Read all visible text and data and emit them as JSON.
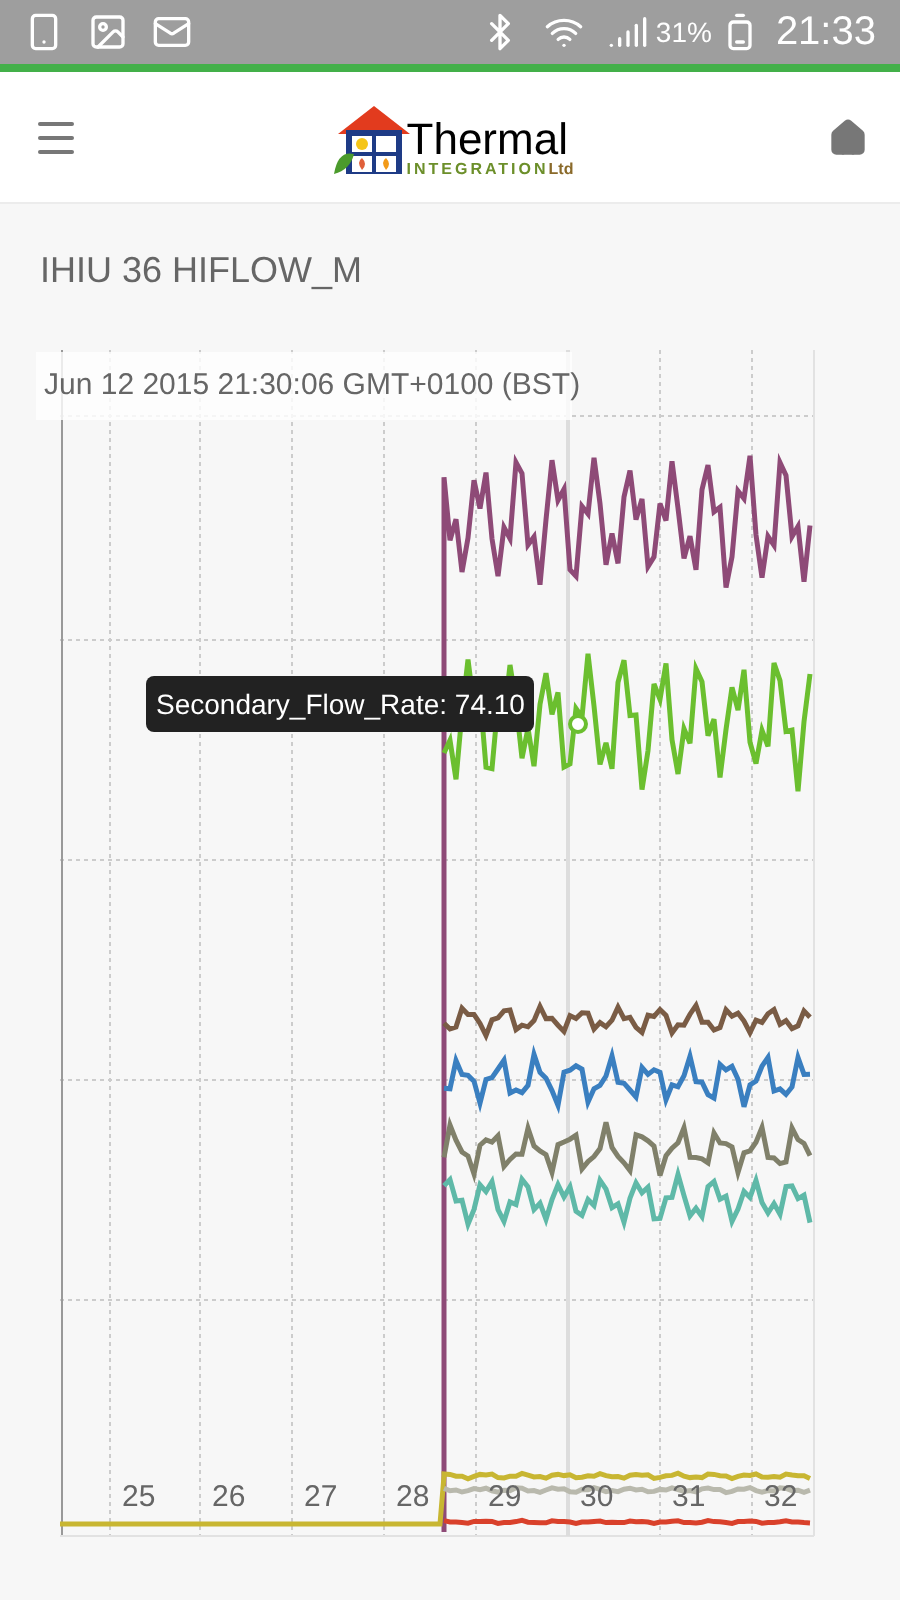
{
  "status_bar": {
    "battery": "31%",
    "time": "21:33"
  },
  "header": {
    "logo_title": "Thermal",
    "logo_subtitle": "INTEGRATION",
    "logo_suffix": "Ltd"
  },
  "page_title": "IHIU 36 HIFLOW_M",
  "chart": {
    "timestamp": "Jun 12 2015 21:30:06 GMT+0100 (BST)",
    "tooltip": "Secondary_Flow_Rate: 74.10",
    "x_labels": [
      "25",
      "26",
      "27",
      "28",
      "29",
      "30",
      "31",
      "32"
    ],
    "series": [
      {
        "color": "#8e4a77"
      },
      {
        "color": "#6bbf2f"
      },
      {
        "color": "#7a5c45"
      },
      {
        "color": "#3a7fc0"
      },
      {
        "color": "#80806a"
      },
      {
        "color": "#5fb9a8"
      },
      {
        "color": "#c8b632"
      },
      {
        "color": "#b9b9ad"
      },
      {
        "color": "#d9412b"
      }
    ]
  }
}
